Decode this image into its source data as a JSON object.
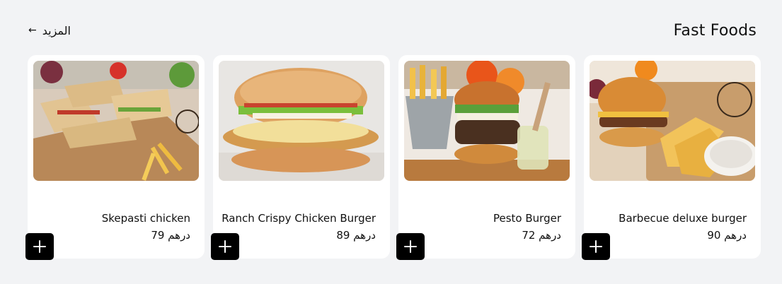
{
  "section": {
    "title": "Fast Foods",
    "more_label": "المزيد",
    "more_icon": "arrow-left-icon"
  },
  "products": [
    {
      "name": "Barbecue deluxe burger",
      "price": "90 درهم",
      "image": "barbecue-burger-with-fries-photo"
    },
    {
      "name": "Pesto Burger",
      "price": "72 درهم",
      "image": "pesto-burger-with-fries-photo"
    },
    {
      "name": "Ranch Crispy Chicken Burger",
      "price": "89 درهم",
      "image": "crispy-chicken-burger-photo"
    },
    {
      "name": "Skepasti chicken",
      "price": "79 درهم",
      "image": "skepasti-chicken-wraps-photo"
    }
  ],
  "add_icon": "plus-icon"
}
